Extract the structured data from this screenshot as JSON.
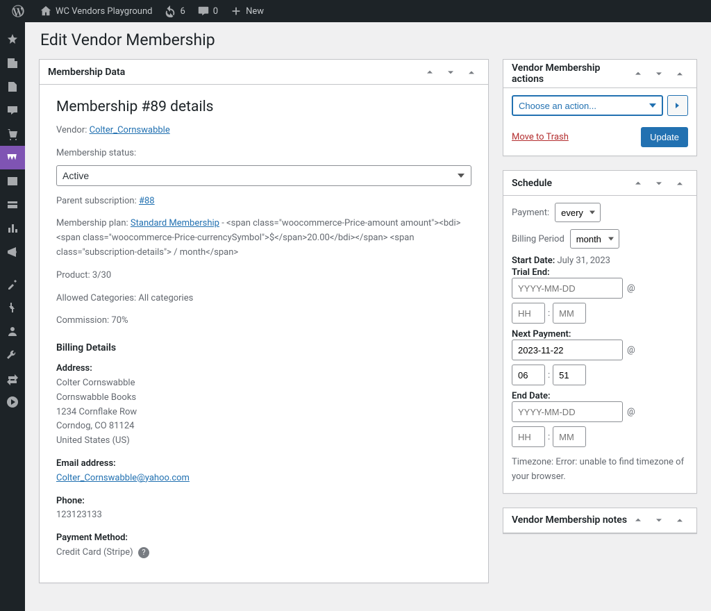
{
  "adminbar": {
    "site_title": "WC Vendors Playground",
    "updates_count": "6",
    "comments_count": "0",
    "new_label": "New"
  },
  "sidemenu": {
    "items": [
      "dashboard",
      "posts",
      "pages",
      "comments",
      "store",
      "woocommerce",
      "products",
      "payments",
      "analytics",
      "marketing",
      "",
      "pins",
      "plugins",
      "users",
      "tools",
      "transfer",
      "play"
    ]
  },
  "page": {
    "heading": "Edit Vendor Membership"
  },
  "membership": {
    "box_title": "Membership Data",
    "details_title": "Membership #89 details",
    "vendor_label": "Vendor:",
    "vendor_name": "Colter_Cornswabble",
    "status_label": "Membership status:",
    "status_value": "Active",
    "parent_label": "Parent subscription:",
    "parent_link": "#88",
    "plan_label": "Membership plan:",
    "plan_link": "Standard Membership",
    "plan_tail": " - <span class=\"woocommerce-Price-amount amount\"><bdi><span class=\"woocommerce-Price-currencySymbol\">$</span>20.00</bdi></span>  <span class=\"subscription-details\"> / month</span>",
    "product_label": "Product:",
    "product_value": "3/30",
    "allowed_label": "Allowed Categories:",
    "allowed_value": "All categories",
    "commission_label": "Commission:",
    "commission_value": "70%",
    "billing_heading": "Billing Details",
    "address_label": "Address:",
    "address_lines": [
      "Colter Cornswabble",
      "Cornswabble Books",
      "1234 Cornflake Row",
      "Corndog, CO 81124",
      "United States (US)"
    ],
    "email_label": "Email address:",
    "email_value": "Colter_Cornswabble@yahoo.com",
    "phone_label": "Phone:",
    "phone_value": "123123133",
    "payment_method_label": "Payment Method:",
    "payment_method_value": "Credit Card (Stripe)"
  },
  "actions": {
    "box_title": "Vendor Membership actions",
    "select_placeholder": "Choose an action...",
    "move_trash": "Move to Trash",
    "update": "Update"
  },
  "schedule": {
    "box_title": "Schedule",
    "payment_label": "Payment:",
    "payment_value": "every",
    "billing_period_label": "Billing Period",
    "billing_period_value": "month",
    "start_date_label": "Start Date:",
    "start_date_value": "July 31, 2023",
    "trial_end_label": "Trial End:",
    "trial_end": {
      "date": "",
      "date_placeholder": "YYYY-MM-DD",
      "hh": "",
      "hh_placeholder": "HH",
      "mm": "",
      "mm_placeholder": "MM"
    },
    "next_payment_label": "Next Payment:",
    "next_payment": {
      "date": "2023-11-22",
      "date_placeholder": "YYYY-MM-DD",
      "hh": "06",
      "hh_placeholder": "HH",
      "mm": "51",
      "mm_placeholder": "MM"
    },
    "end_date_label": "End Date:",
    "end_date": {
      "date": "",
      "date_placeholder": "YYYY-MM-DD",
      "hh": "",
      "hh_placeholder": "HH",
      "mm": "",
      "mm_placeholder": "MM"
    },
    "timezone_note": "Timezone: Error: unable to find timezone of your browser."
  },
  "notes": {
    "box_title": "Vendor Membership notes"
  }
}
